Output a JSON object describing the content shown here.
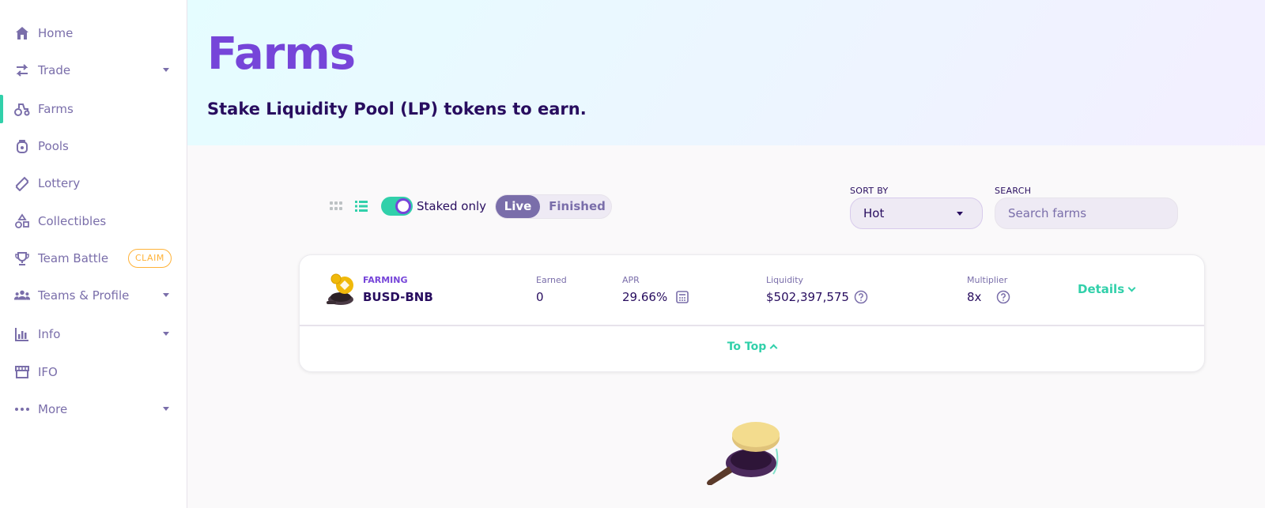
{
  "sidebar": {
    "items": [
      {
        "label": "Home",
        "icon": "home-icon",
        "has_caret": false
      },
      {
        "label": "Trade",
        "icon": "swap-icon",
        "has_caret": true
      },
      {
        "label": "Farms",
        "icon": "tractor-icon",
        "has_caret": false,
        "active": true
      },
      {
        "label": "Pools",
        "icon": "pool-jar-icon",
        "has_caret": false
      },
      {
        "label": "Lottery",
        "icon": "ticket-icon",
        "has_caret": false
      },
      {
        "label": "Collectibles",
        "icon": "shapes-icon",
        "has_caret": false
      },
      {
        "label": "Team Battle",
        "icon": "trophy-icon",
        "has_caret": false,
        "badge": "CLAIM"
      },
      {
        "label": "Teams & Profile",
        "icon": "group-icon",
        "has_caret": true
      },
      {
        "label": "Info",
        "icon": "chart-icon",
        "has_caret": true
      },
      {
        "label": "IFO",
        "icon": "store-icon",
        "has_caret": false
      },
      {
        "label": "More",
        "icon": "more-dots-icon",
        "has_caret": true
      }
    ]
  },
  "hero": {
    "title": "Farms",
    "subtitle": "Stake Liquidity Pool (LP) tokens to earn."
  },
  "controls": {
    "staked_only_label": "Staked only",
    "staked_only_on": true,
    "tabs": {
      "live": "Live",
      "finished": "Finished"
    },
    "sort_label": "SORT BY",
    "sort_value": "Hot",
    "search_label": "SEARCH",
    "search_placeholder": "Search farms"
  },
  "farm": {
    "tag": "FARMING",
    "pair": "BUSD-BNB",
    "earned_label": "Earned",
    "earned_value": "0",
    "apr_label": "APR",
    "apr_value": "29.66%",
    "liquidity_label": "Liquidity",
    "liquidity_value": "$502,397,575",
    "multiplier_label": "Multiplier",
    "multiplier_value": "8x",
    "details_label": "Details",
    "to_top_label": "To Top"
  },
  "colors": {
    "primary": "#7645d9",
    "secondary": "#7a6eaa",
    "text": "#280d5f",
    "success": "#31d0aa",
    "warning": "#ffb237"
  }
}
